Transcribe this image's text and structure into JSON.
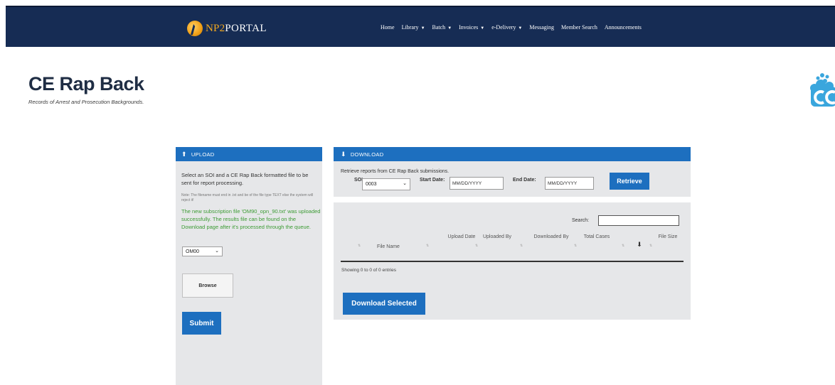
{
  "brand": {
    "name_accent": "NP2",
    "name_rest": "PORTAL"
  },
  "nav": {
    "items": [
      {
        "label": "Home",
        "dropdown": false
      },
      {
        "label": "Library",
        "dropdown": true
      },
      {
        "label": "Batch",
        "dropdown": true
      },
      {
        "label": "Invoices",
        "dropdown": true
      },
      {
        "label": "e-Delivery",
        "dropdown": true
      },
      {
        "label": "Messaging",
        "dropdown": false
      },
      {
        "label": "Member Search",
        "dropdown": false
      },
      {
        "label": "Announcements",
        "dropdown": false
      }
    ]
  },
  "page": {
    "title": "CE Rap Back",
    "subtitle": "Records of Arrest and Prosecution Backgrounds."
  },
  "upload": {
    "header": "UPLOAD",
    "instructions": "Select an SOI and a CE Rap Back formatted file to be sent for report processing.",
    "note": "Note: The filename must end in .txt and be of the file type TEXT else the system will reject it!",
    "success_message": "The new subscription file 'OM90_opn_90.txt' was uploaded successfully. The results file can be found on the Download page after it's processed through the queue.",
    "soi_selected": "OM00",
    "browse_label": "Browse",
    "submit_label": "Submit"
  },
  "download": {
    "header": "DOWNLOAD",
    "intro": "Retrieve reports from CE Rap Back submissions.",
    "soi_label": "SOI:",
    "soi_selected": "0003",
    "start_label": "Start Date:",
    "start_placeholder": "MM/DD/YYYY",
    "end_label": "End Date:",
    "end_placeholder": "MM/DD/YYYY",
    "retrieve_label": "Retrieve",
    "search_label": "Search:",
    "columns": [
      "File Name",
      "Upload Date",
      "Uploaded By",
      "Downloaded By",
      "Total Cases",
      "",
      "File Size"
    ],
    "empty_info": "Showing 0 to 0 of 0 entries",
    "download_selected_label": "Download Selected"
  },
  "colors": {
    "navbar": "#162c54",
    "accent_blue": "#1d6fbf",
    "logo_gold": "#f3a81f",
    "success_green": "#3c9b34",
    "panel_gray": "#e6e7e9"
  },
  "icons": {
    "upload_header": "upload-icon",
    "download_header": "download-icon",
    "download_column": "download-column-icon",
    "brand_corner": "cloud-brand-icon"
  }
}
